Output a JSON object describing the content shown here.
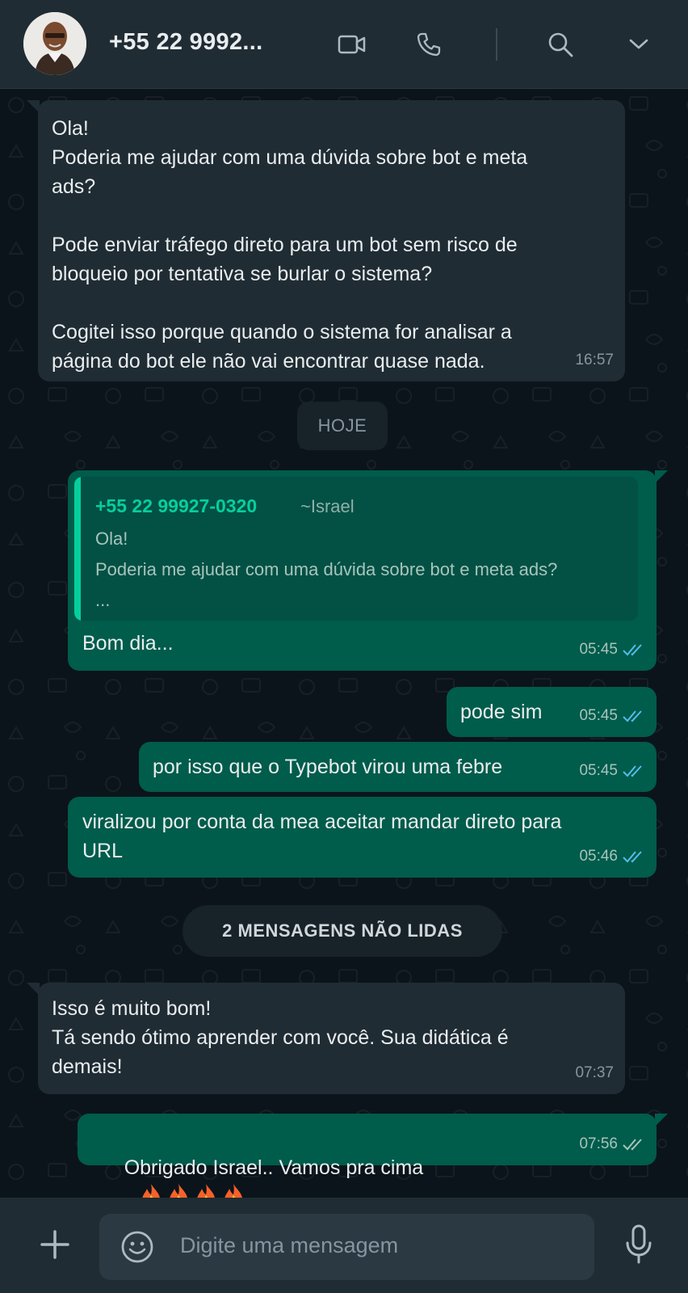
{
  "header": {
    "contact_name": "+55 22 9992...",
    "icons": [
      "video-call-icon",
      "voice-call-icon",
      "search-icon",
      "chevron-down-icon"
    ]
  },
  "messages": [
    {
      "direction": "in",
      "text": "Ola!\nPoderia me ajudar com uma dúvida sobre bot e meta\nads?\n\nPode enviar tráfego direto para um bot sem risco de\nbloqueio por tentativa se burlar o sistema?\n\nCogitei isso porque quando o sistema for analisar a\npágina do bot ele não vai encontrar quase nada.",
      "time": "16:57"
    },
    {
      "direction": "out",
      "text": "Bom dia...",
      "time": "05:45",
      "status": "read",
      "quote": {
        "name": "+55 22 99927-0320",
        "alias": "~Israel",
        "text": "Ola!\nPoderia me ajudar com uma dúvida sobre bot e meta ads?\n..."
      }
    },
    {
      "direction": "out",
      "text": "pode sim",
      "time": "05:45",
      "status": "read"
    },
    {
      "direction": "out",
      "text": "por isso que o Typebot virou uma febre",
      "time": "05:45",
      "status": "read"
    },
    {
      "direction": "out",
      "text": "viralizou por conta da mea aceitar mandar direto para\nURL",
      "time": "05:46",
      "status": "read"
    },
    {
      "direction": "in",
      "text": "Isso é muito bom!\nTá sendo ótimo aprender com você. Sua didática é\ndemais!",
      "time": "07:37"
    },
    {
      "direction": "out",
      "text": "Obrigado Israel.. Vamos pra cima",
      "emoji": "🔥🔥🔥🔥",
      "time": "07:56",
      "status": "delivered"
    }
  ],
  "dividers": {
    "today": "HOJE",
    "unread": "2 MENSAGENS NÃO LIDAS"
  },
  "composer": {
    "placeholder": "Digite uma mensagem"
  },
  "colors": {
    "header_bg": "#202c33",
    "chat_bg": "#0b141a",
    "incoming_bubble": "#202c33",
    "outgoing_bubble": "#005c4b",
    "read_tick": "#53bdeb",
    "accent_green": "#06cf9c"
  }
}
